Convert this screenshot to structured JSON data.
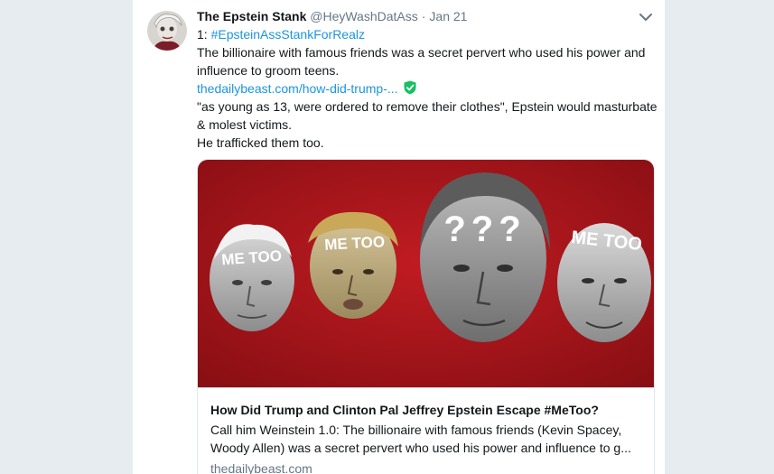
{
  "tweet": {
    "author_name": "The Epstein Stank",
    "author_handle": "@HeyWashDatAss",
    "separator": "·",
    "date": "Jan 21",
    "thread_prefix": "1: ",
    "hashtag": "#EpsteinAssStankForRealz",
    "text_line_1": "The billionaire with famous friends was a secret pervert who used his power and",
    "text_line_2": "influence to groom teens.",
    "link_text": "thedailybeast.com/how-did-trump-...",
    "text_line_3": "\"as young as 13, were ordered to remove their clothes\", Epstein would masturbate",
    "text_line_4": "& molest victims.",
    "text_line_5": "He trafficked them too."
  },
  "card": {
    "image_faces": [
      {
        "label": "ME TOO"
      },
      {
        "label": "ME TOO"
      },
      {
        "label": "???"
      },
      {
        "label": "ME TOO"
      }
    ],
    "title": "How Did Trump and Clinton Pal Jeffrey Epstein Escape #MeToo?",
    "description_line_1": "Call him Weinstein 1.0: The billionaire with famous friends (Kevin Spacey,",
    "description_line_2": "Woody Allen) was a secret pervert who used his power and influence to g...",
    "domain": "thedailybeast.com"
  },
  "colors": {
    "link": "#1b95e0",
    "shield": "#17bf63",
    "card_background": "#a8151c"
  },
  "icons": {
    "caret": "chevron-down-icon",
    "verified_link": "shield-check-icon"
  }
}
